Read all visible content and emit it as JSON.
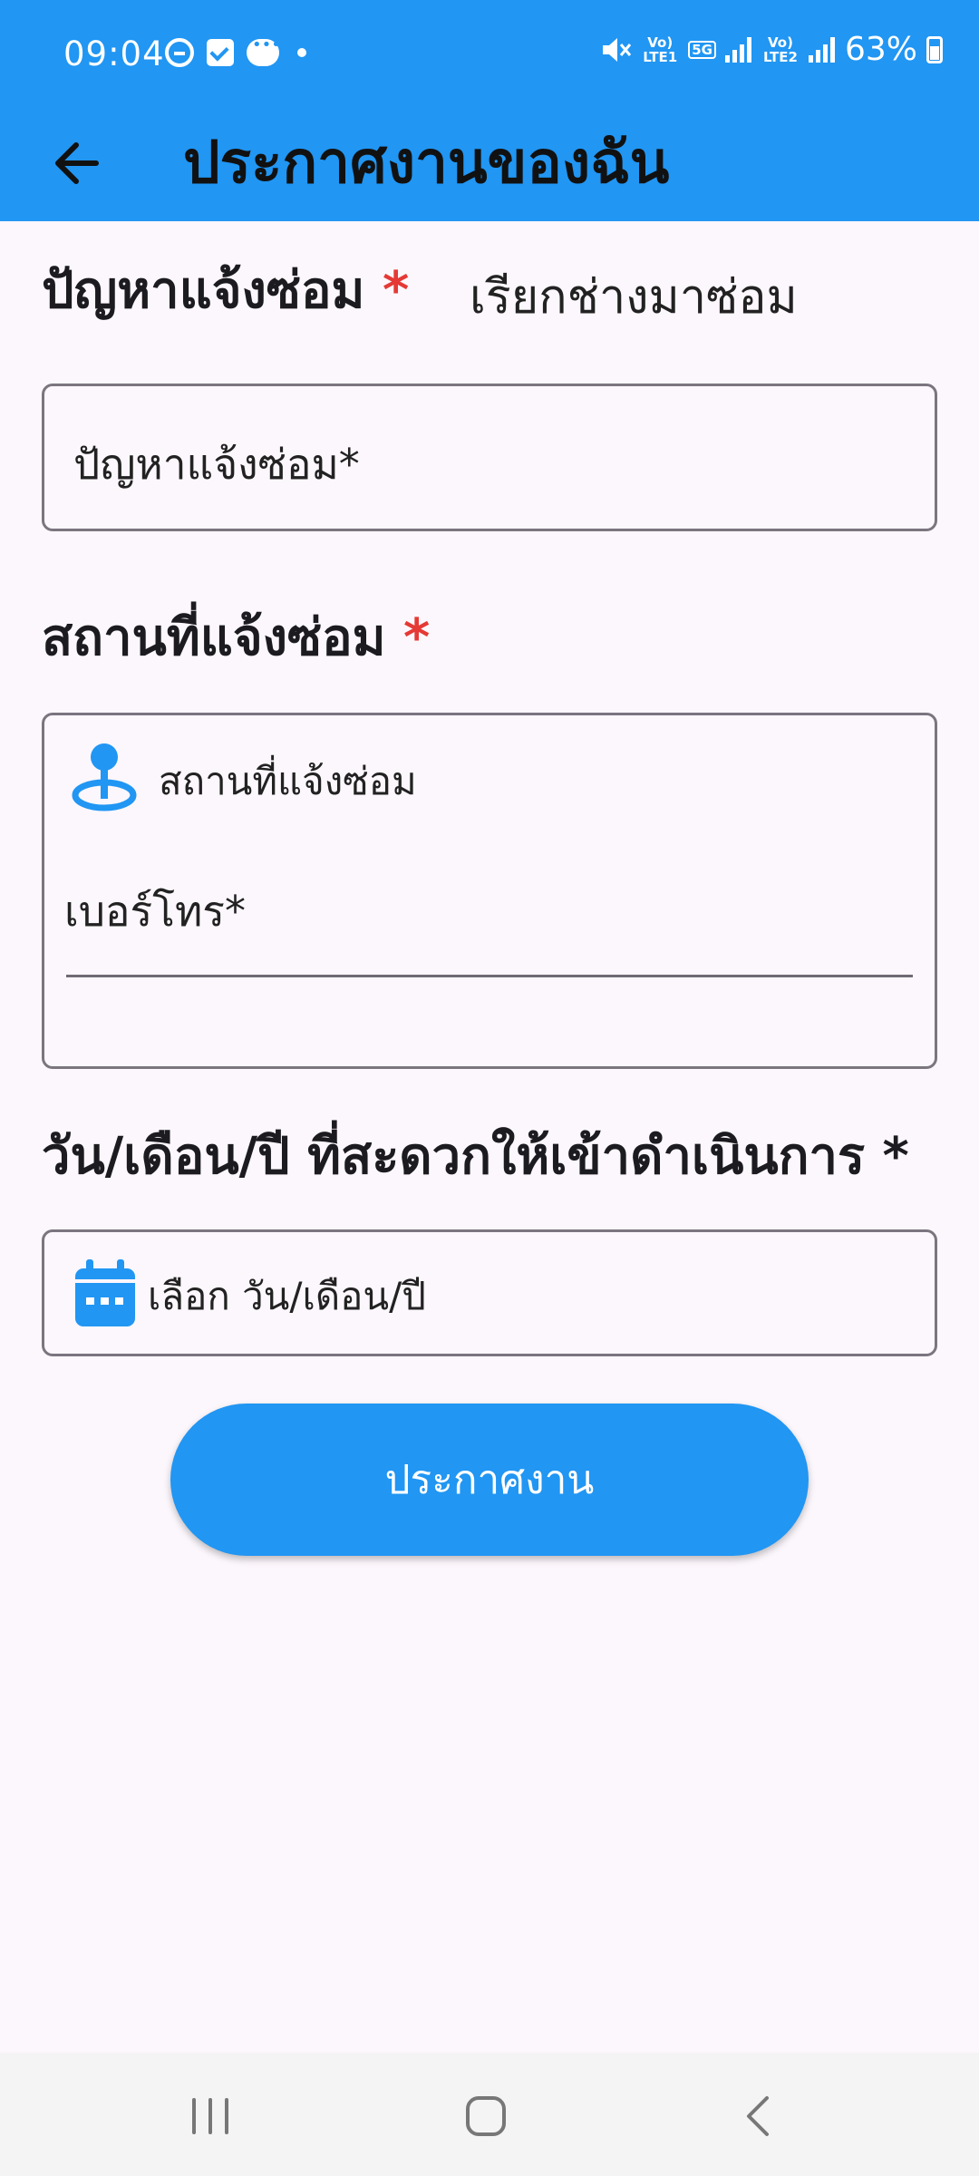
{
  "status": {
    "time": "09:04",
    "lte1": "Vo) LTE1",
    "net5g": "5G",
    "lte2": "Vo) LTE2",
    "battery": "63%"
  },
  "appbar": {
    "title": "ประกาศงานของฉัน"
  },
  "form": {
    "problem_label": "ปัญหาแจ้งซ่อม",
    "problem_value": "เรียกช่างมาซ่อม",
    "problem_placeholder": "ปัญหาแจ้งซ่อม*",
    "location_label": "สถานที่แจ้งซ่อม",
    "location_placeholder": "สถานที่แจ้งซ่อม",
    "phone_placeholder": "เบอร์โทร*",
    "date_label": "วัน/เดือน/ปี ที่สะดวกให้เข้าดำเนินการ *",
    "date_placeholder": "เลือก วัน/เดือน/ปี",
    "required_mark": "*"
  },
  "submit": {
    "label": "ประกาศงาน"
  },
  "colors": {
    "primary": "#2196f3",
    "required": "#e53935",
    "background": "#fcf7fc"
  }
}
